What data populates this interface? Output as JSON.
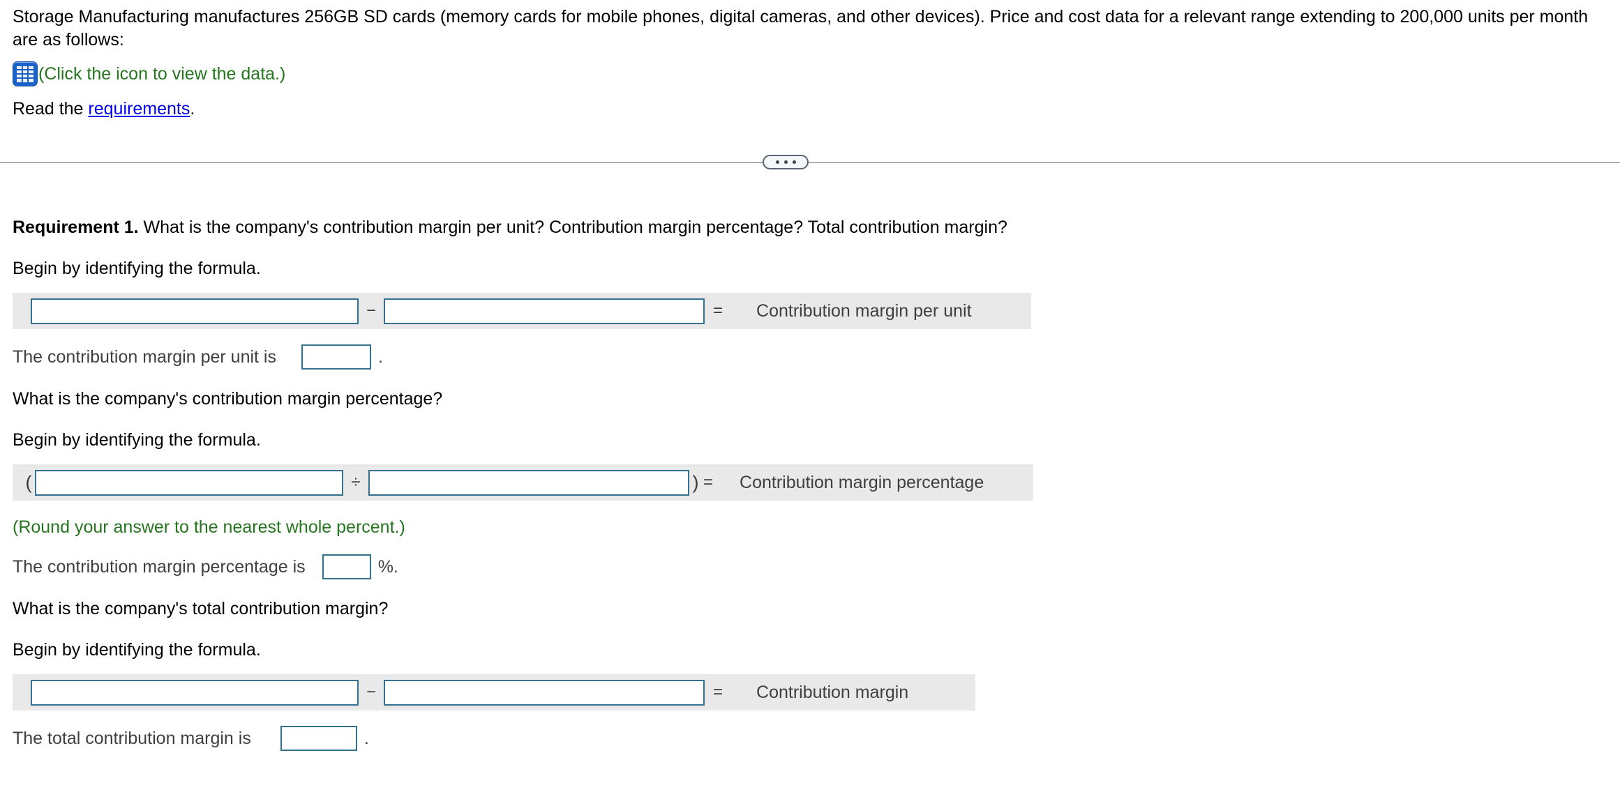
{
  "intro": {
    "paragraph": "Storage Manufacturing manufactures 256GB SD cards (memory cards for mobile phones, digital cameras, and other devices). Price and cost data for a relevant range extending to 200,000 units per month are as follows:",
    "icon_name": "spreadsheet-icon",
    "icon_note": "(Click the icon to view the data.)",
    "read_prefix": "Read the ",
    "read_link": "requirements",
    "read_suffix": "."
  },
  "divider": {
    "name": "collapsible-divider",
    "dots": 3
  },
  "requirement": {
    "label": "Requirement 1.",
    "question": " What is the company's contribution margin per unit? Contribution margin percentage? Total contribution margin?"
  },
  "sections": {
    "per_unit": {
      "prompt": "Begin by identifying the formula.",
      "operator": "−",
      "equals": "=",
      "result_label": "Contribution margin per unit",
      "answer_label": "The contribution margin per unit is",
      "answer_suffix": "."
    },
    "percentage": {
      "question": "What is the company's contribution margin percentage?",
      "prompt": "Begin by identifying the formula.",
      "open_paren": "(",
      "operator": "÷",
      "close_paren": ")",
      "equals": "=",
      "result_label": "Contribution margin percentage",
      "round_note": "(Round your answer to the nearest whole percent.)",
      "answer_label": "The contribution margin percentage is",
      "answer_suffix": "%."
    },
    "total": {
      "question": "What is the company's total contribution margin?",
      "prompt": "Begin by identifying the formula.",
      "operator": "−",
      "equals": "=",
      "result_label": "Contribution margin",
      "answer_label": "The total contribution margin is",
      "answer_suffix": "."
    }
  },
  "inputs": {
    "f1a": "",
    "f1b": "",
    "f2a": "",
    "f2b": "",
    "f3a": "",
    "f3b": "",
    "ans1": "",
    "ans2": "",
    "ans3": ""
  },
  "colors": {
    "input_border": "#35708f",
    "formula_bg": "#e9e9e9",
    "note_green": "#25761f",
    "link_blue": "#0000ee",
    "icon_blue": "#1a62c9"
  }
}
